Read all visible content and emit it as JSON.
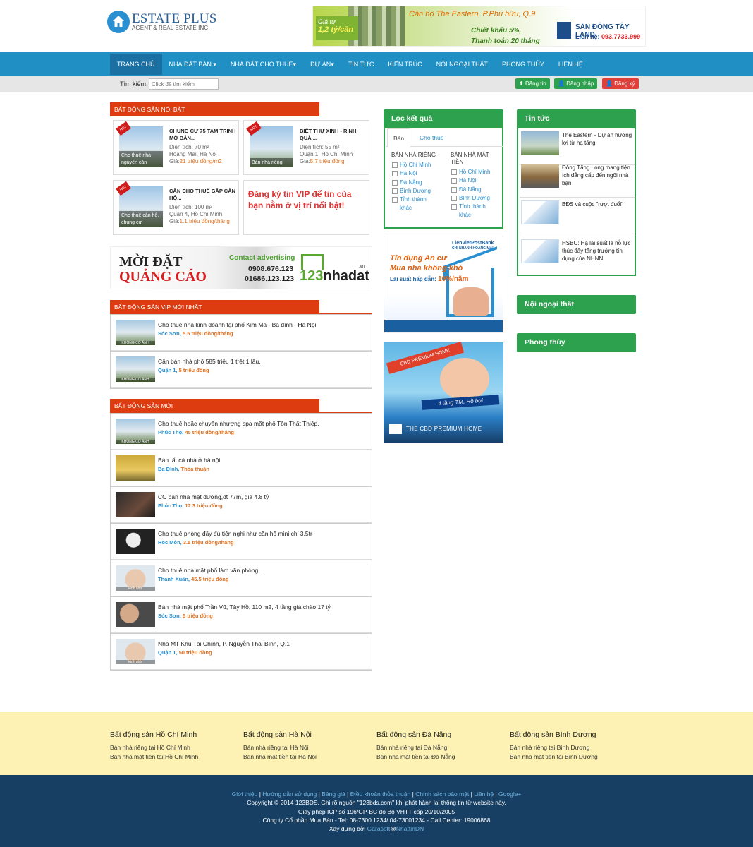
{
  "header": {
    "logo_title": "ESTATE PLUS",
    "logo_subtitle": "AGENT & REAL ESTATE INC.",
    "ad": {
      "price_prefix": "Giá từ",
      "price": "1,2 tỷ/căn",
      "headline": "Căn hộ The Eastern, P.Phú hữu, Q.9",
      "offer1": "Chiết khấu 5%,",
      "offer2": "Thanh toán 20 tháng",
      "company": "SÀN ĐÔNG TÂY LAND",
      "contact_label": "Liên hệ:",
      "phone": "093.7733.999"
    }
  },
  "nav": {
    "items": [
      {
        "label": "Trang chủ",
        "active": true
      },
      {
        "label": "Nhà đất bán ▾"
      },
      {
        "label": "Nhà đất cho thuê▾"
      },
      {
        "label": "Dự án▾"
      },
      {
        "label": "Tin tức"
      },
      {
        "label": "Kiến trúc"
      },
      {
        "label": "Nội ngoại thất"
      },
      {
        "label": "Phong thủy"
      },
      {
        "label": "Liên hệ"
      }
    ]
  },
  "search": {
    "label": "Tìm kiếm:",
    "placeholder": "Click để tìm kiếm",
    "post_label": "Đăng tin",
    "login_label": "Đăng nhập",
    "register_label": "Đăng ký"
  },
  "featured": {
    "title": "Bất động sản nổi bật",
    "cards": [
      {
        "title": "CHUNG CƯ 75 TAM TRINH MỞ BÁN...",
        "caption": "Cho thuê nhà nguyên căn",
        "area": "Diện tích: 70 m²",
        "location": "Hoàng Mai, Hà Nội",
        "price_label": "Giá:",
        "price": "21 triệu đồng/m2"
      },
      {
        "title": "BIỆT THỰ XINH - RINH QUÀ ...",
        "caption": "Bán nhà riêng",
        "area": "Diện tích: 55 m²",
        "location": "Quận 1, Hồ Chí Minh",
        "price_label": "Giá:",
        "price": "5.7 triệu đồng"
      },
      {
        "title": "CẦN CHO THUÊ GẤP CĂN HỘ...",
        "caption": "Cho thuê căn hộ, chung cư",
        "area": "Diện tích: 100 m²",
        "location": "Quận 4, Hồ Chí Minh",
        "price_label": "Giá:",
        "price": "1.1 triệu đồng/tháng"
      }
    ],
    "hot_badge": "HOT",
    "vip_promo": "Đăng ký tin VIP để tin của bạn nằm ở vị trí nổi bật!"
  },
  "adbanner": {
    "line1": "MỜI ĐẶT",
    "line2": "QUẢNG CÁO",
    "contact": "Contact advertising",
    "phone1": "0908.676.123",
    "phone2": "01686.123.123",
    "brand_num": "123",
    "brand_name": "nhadat",
    "brand_tld": ".vn"
  },
  "vip": {
    "title": "Bất động sản VIP mới nhất",
    "items": [
      {
        "title": "Cho thuê nhà kinh doanh tại phố Kim Mã - Ba đình - Hà Nội",
        "location": "Sóc Sơn,",
        "price": "5.5 triệu đồng/tháng",
        "thumb": "KHÔNG CÓ ẢNH"
      },
      {
        "title": "Cần bán nhà phố 585 triệu 1 trệt 1 lầu.",
        "location": "Quận 1,",
        "price": "5 triệu đồng",
        "thumb": "KHÔNG CÓ ẢNH"
      }
    ]
  },
  "latest": {
    "title": "Bất động sản mới",
    "items": [
      {
        "title": "Cho thuê hoặc chuyển nhượng spa mặt phố Tôn Thất Thiệp.",
        "location": "Phúc Thọ,",
        "price": "45 triệu đồng/tháng",
        "thumb": "KHÔNG CÓ ẢNH"
      },
      {
        "title": "Bán tất cả nhà ở hà nội",
        "location": "Ba Đình,",
        "price": "Thỏa thuận",
        "thumb": ""
      },
      {
        "title": "CC bán nhà mặt đường,dt 77m, giá 4.8 tỷ",
        "location": "Phúc Thọ,",
        "price": "12.3 triệu đồng",
        "thumb": ""
      },
      {
        "title": "Cho thuê phòng đầy đủ tiện nghi như căn hộ mini chỉ 3,5tr",
        "location": "Hóc Môn,",
        "price": "3.5 triệu đồng/tháng",
        "thumb": ""
      },
      {
        "title": "Cho thuê nhà mặt phố làm văn phòng .",
        "location": "Thanh Xuân,",
        "price": "45.5 triệu đồng",
        "thumb": "kinh nhờ"
      },
      {
        "title": "Bán nhà mặt phố Trần Vũ, Tây Hồ, 110 m2, 4 tầng giá chào 17 tỷ",
        "location": "Sóc Sơn,",
        "price": "5 triệu đồng",
        "thumb": ""
      },
      {
        "title": "Nhà MT Khu Tài Chính, P. Nguyễn Thái Bình, Q.1",
        "location": "Quận 1,",
        "price": "50 triệu đồng",
        "thumb": "kinh nhờ"
      }
    ]
  },
  "filter": {
    "title": "Lọc kết quả",
    "tab_sale": "Bán",
    "tab_rent": "Cho thuê",
    "col1_title": "BÁN NHÀ RIÊNG",
    "col2_title": "BÁN NHÀ MẶT TIỀN",
    "cities": [
      "Hồ Chí Minh",
      "Hà Nội",
      "Đà Nẵng",
      "Bình Dương",
      "Tỉnh thành khác"
    ]
  },
  "side_ads": {
    "bank": "LienVietPostBank",
    "bank_branch": "CHI NHÁNH HOÀNG MAI",
    "loan1": "Tín dụng An cư",
    "loan2": "Mua nhà không khó",
    "rate_label": "Lãi suất hấp dẫn:",
    "rate": "10%/năm",
    "cbd_ribbon": "CBD PREMIUM HOME",
    "cbd_strip": "4 tầng TM, Hồ bơi",
    "cbd_bottom": "THE CBD PREMIUM HOME"
  },
  "news": {
    "title": "Tin tức",
    "items": [
      "The Eastern - Dự án hướng lợi từ hạ tầng",
      "Đông Tăng Long mang tiện ích đẳng cấp đến ngôi nhà bạn",
      "BĐS và cuộc \"rượt đuổi\"",
      "HSBC: Hạ lãi suất là nỗ lực thúc đẩy tăng trưởng tín dụng của NHNN"
    ],
    "interior": "Nội ngoại thất",
    "fengshui": "Phong thủy"
  },
  "footer_links": [
    {
      "title": "Bất động sản Hồ Chí Minh",
      "l1": "Bán nhà riêng tại Hồ Chí Minh",
      "l2": "Bán nhà mặt tiền tại Hồ Chí Minh"
    },
    {
      "title": "Bất động sản Hà Nội",
      "l1": "Bán nhà riêng tại Hà Nội",
      "l2": "Bán nhà mặt tiền tại Hà Nội"
    },
    {
      "title": "Bất động sản Đà Nẵng",
      "l1": "Bán nhà riêng tại Đà Nẵng",
      "l2": "Bán nhà mặt tiền tại Đà Nẵng"
    },
    {
      "title": "Bất động sản Bình Dương",
      "l1": "Bán nhà riêng tại Bình Dương",
      "l2": "Bán nhà mặt tiền tại Bình Dương"
    }
  ],
  "footer": {
    "links": [
      "Giới thiệu",
      "Hướng dẫn sử dụng",
      "Bảng giá",
      "Điều khoản thỏa thuận",
      "Chính sách bảo mật",
      "Liên hệ",
      "Google+"
    ],
    "copyright": "Copyright © 2014 123BDS. Ghi rõ nguồn \"123bds.com\" khi phát hành lại thông tin từ website này.",
    "license": "Giấy phép ICP số 196/GP-BC do Bộ VHTT cấp 20/10/2005",
    "company": "Công ty Cổ phần Mua Bán - Tel: 08-7300 1234/ 04-73001234 - Call Center: 19006868",
    "built_by": "Xây dựng bởi",
    "builder1": "Garasoft",
    "at": "@",
    "builder2": "NhattinDN"
  },
  "colors": {
    "nav": "#1f8fc4",
    "section": "#dd3c10",
    "green": "#2ea14f",
    "footer_top": "#fdf2b3",
    "footer_bottom": "#163f63"
  }
}
